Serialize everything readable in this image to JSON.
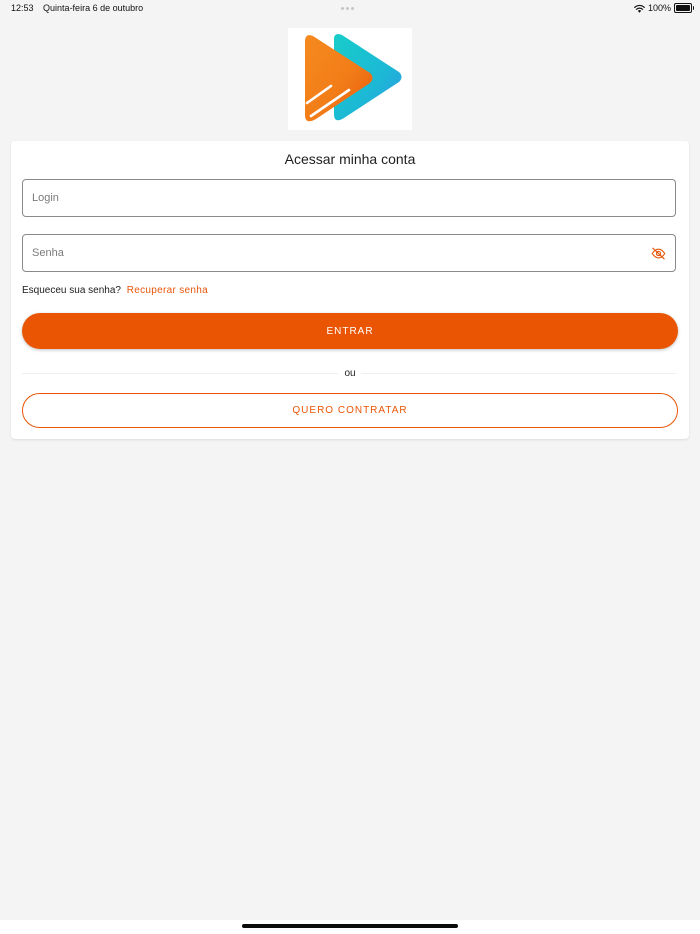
{
  "status_bar": {
    "time": "12:53",
    "date": "Quinta-feira 6 de outubro",
    "battery_percent": "100%",
    "battery_level": 1.0,
    "wifi_icon": "wifi-icon",
    "battery_icon": "battery-icon"
  },
  "logo": {
    "icon": "play-arrows-logo",
    "colors": {
      "orange": "#f28a1e",
      "orange_dark": "#e8560a",
      "teal": "#1cc6cc",
      "blue": "#2a9fe0"
    }
  },
  "login_card": {
    "title": "Acessar minha conta",
    "login_placeholder": "Login",
    "login_value": "",
    "password_placeholder": "Senha",
    "password_value": "",
    "password_toggle_icon": "eye-off-icon",
    "forgot_text": "Esqueceu sua senha?",
    "recover_link": "Recuperar senha",
    "enter_button": "ENTRAR",
    "or_text": "ou",
    "hire_button": "QUERO CONTRATAR"
  },
  "colors": {
    "accent": "#ea5504",
    "background": "#f4f4f4",
    "card": "#ffffff"
  }
}
